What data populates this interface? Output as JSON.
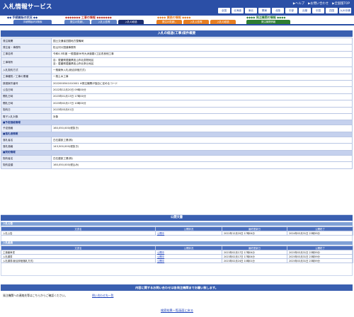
{
  "header": {
    "logo": "入札情報サービス",
    "links": [
      "▶ヘルプ",
      "▶お問い合わせ",
      "▶全国版TOP"
    ],
    "regions": [
      "全国",
      "北海道",
      "東北",
      "関東",
      "北陸",
      "中部",
      "近畿",
      "中国",
      "四国",
      "九州沖縄"
    ]
  },
  "categories": [
    {
      "label": "◆◆ 手続開始の状況 ◆◆",
      "color": "#1e3a8a"
    },
    {
      "label": "◆◆◆◆◆◆◆ 工事の情報 ◆◆◆◆◆◆◆",
      "color": "#c0392b"
    },
    {
      "label": "◆◆◆◆ 業務の情報 ◆◆◆◆",
      "color": "#e67e22"
    },
    {
      "label": "◆◆◆◆ 発注機関の情報 ◆◆◆◆",
      "color": "#2e7d32"
    }
  ],
  "tabs": [
    {
      "label": "手続開始状況検索",
      "color": "#4b6fbd"
    },
    {
      "label": "発注の見通し",
      "color": "#5f81c4"
    },
    {
      "label": "入札公告等",
      "color": "#5f81c4"
    },
    {
      "label": "入札の経過",
      "color": "#1e2f6e"
    },
    {
      "label": "発注の見通し",
      "color": "#e67e22"
    },
    {
      "label": "入札公告等",
      "color": "#e67e22"
    },
    {
      "label": "入札の経過",
      "color": "#e67e22"
    },
    {
      "label": "発注機関情報",
      "color": "#2e7d32"
    }
  ],
  "main": {
    "title": "入札の経過(工事)案件概要",
    "rows": [
      {
        "k": "発注機関",
        "v": "国土交通省四国地方整備局"
      },
      {
        "k": "発注者・事務所",
        "v": "松山河川国道事務所"
      },
      {
        "k": "工事名称",
        "v": "令和4-5年度 一般国道56号大洲道路1工区改良他工事"
      },
      {
        "k": "工事場所",
        "v": "自：愛媛県愛媛県松山市北斎院地区\n至：愛媛県愛媛県松山市北条辻地区",
        "tall": true
      },
      {
        "k": "入札契約方式",
        "v": "一般競争入札(総合評価方式)"
      },
      {
        "k": "工事種別／工事の業種",
        "v": "一般土木工事"
      },
      {
        "k": "調達案件番号",
        "v": "2022000541010001 ※発注機関が独自に定めるコード"
      },
      {
        "k": "公告日時",
        "v": "2022年12月20日 09時00分"
      },
      {
        "k": "開札日時",
        "v": "2023年01月13日 17時00分"
      },
      {
        "k": "開札日時",
        "v": "2023年02月17日 10時00分"
      },
      {
        "k": "契約日",
        "v": "2023年03月01日"
      },
      {
        "k": "電子入札対象",
        "v": "対象"
      }
    ],
    "sections": [
      {
        "title": "■予定価格情報",
        "rows": [
          {
            "k": "予定価格",
            "v": "160,050,000(税抜き)"
          }
        ]
      },
      {
        "title": "■落札者情報",
        "rows": [
          {
            "k": "落札者名",
            "v": "白石建設工業(株)"
          },
          {
            "k": "落札価格",
            "v": "143,500,000(税抜き)"
          }
        ]
      },
      {
        "title": "■契約情報",
        "rows": [
          {
            "k": "契約者名",
            "v": "白石建設工業(株)"
          },
          {
            "k": "契約金額",
            "v": "160,050,000(税込み)"
          }
        ]
      }
    ]
  },
  "public_docs": {
    "title": "公開文書",
    "koukoku": {
      "label": "入札公告",
      "headers": [
        "文書名",
        "公開状況",
        "最終更新日",
        "公開終了"
      ],
      "rows": [
        [
          "入札公告",
          "公開中",
          "2022年12月20日 17時04分",
          "2024年03月31日 23時59分"
        ]
      ]
    },
    "keika": {
      "label": "入札経過",
      "headers": [
        "文書名",
        "公開状況",
        "最終更新日",
        "公開終了"
      ],
      "rows": [
        [
          "工事競争書",
          "公開中",
          "2023年02月17日 17時04分",
          "2025年03月31日 23時59分"
        ],
        [
          "入札調書",
          "公開中",
          "2023年02月17日 17時04分",
          "2025年03月31日 23時59分"
        ],
        [
          "入札調書(総合評価落札方式)",
          "公開中",
          "2023年02月24日 10時01分",
          "2025年03月31日 23時59分"
        ]
      ]
    }
  },
  "notice": "内容に関するお問い合わせは各発注機関までお願い致します。",
  "contact": {
    "text": "発注機関への連絡先等はこちらからご確認ください。",
    "link": "問い合わせ先一覧"
  },
  "back": "検索結果一覧画面に戻る"
}
